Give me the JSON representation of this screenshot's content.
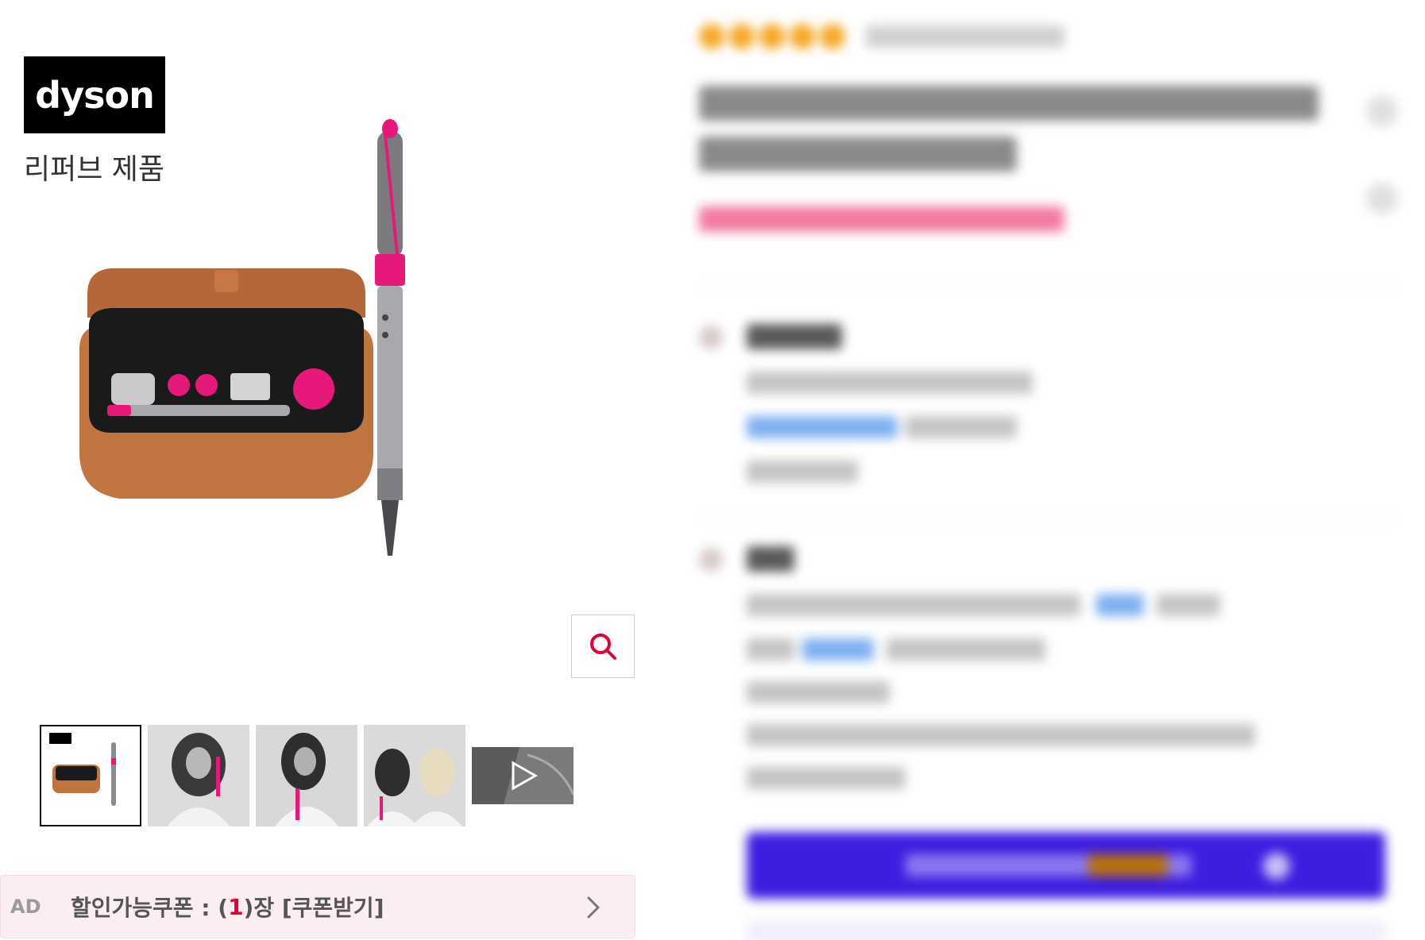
{
  "brand": {
    "logo_text": "dyson",
    "subtitle": "리퍼브 제품"
  },
  "gallery": {
    "zoom_icon": "search-icon",
    "thumbnails": [
      {
        "name": "thumbnail-product-set",
        "active": true
      },
      {
        "name": "thumbnail-model-1",
        "active": false
      },
      {
        "name": "thumbnail-model-2",
        "active": false
      },
      {
        "name": "thumbnail-model-3",
        "active": false
      },
      {
        "name": "thumbnail-video",
        "active": false,
        "icon": "play-icon"
      }
    ]
  },
  "coupon": {
    "ad_label": "AD",
    "text_before": "할인가능쿠폰 : (",
    "count": "1",
    "text_after": ")장 [쿠폰받기]",
    "chevron_icon": "chevron-right-icon",
    "count_color": "#e60033",
    "background": "#fbeef1"
  },
  "colors": {
    "accent_pink": "#e6197a",
    "buy_button": "#3d1de0",
    "star": "#f5a623"
  }
}
